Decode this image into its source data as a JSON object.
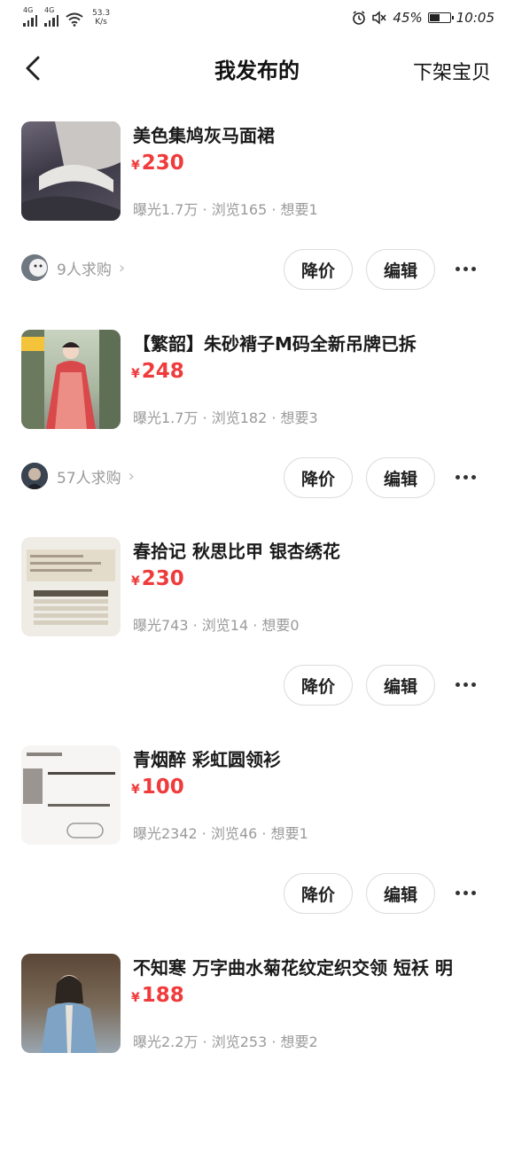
{
  "status_bar": {
    "signal1_label": "4G",
    "signal2_label": "4G",
    "speed_value": "53.3",
    "speed_unit": "K/s",
    "battery_percent": "45%",
    "battery_level": 0.45,
    "time": "10:05"
  },
  "header": {
    "title": "我发布的",
    "action": "下架宝贝"
  },
  "items": [
    {
      "name": "美色集鸠灰马面裙",
      "currency": "¥",
      "price": "230",
      "stats": "曝光1.7万 · 浏览165 · 想要1",
      "buyers": "9人求购",
      "price_cut_label": "降价",
      "edit_label": "编辑"
    },
    {
      "name": "【繁韶】朱砂褙子M码全新吊牌已拆",
      "currency": "¥",
      "price": "248",
      "stats": "曝光1.7万 · 浏览182 · 想要3",
      "buyers": "57人求购",
      "price_cut_label": "降价",
      "edit_label": "编辑"
    },
    {
      "name": "春拾记 秋思比甲 银杏绣花",
      "currency": "¥",
      "price": "230",
      "stats": "曝光743 · 浏览14 · 想要0",
      "price_cut_label": "降价",
      "edit_label": "编辑"
    },
    {
      "name": "青烟醉 彩虹圆领衫",
      "currency": "¥",
      "price": "100",
      "stats": "曝光2342 · 浏览46 · 想要1",
      "price_cut_label": "降价",
      "edit_label": "编辑"
    },
    {
      "name": "不知寒 万字曲水菊花纹定织交领 短袄 明",
      "currency": "¥",
      "price": "188",
      "stats": "曝光2.2万 · 浏览253 · 想要2"
    }
  ],
  "colors": {
    "price_red": "#ef3b3b",
    "muted_text": "#9a9a9a"
  }
}
